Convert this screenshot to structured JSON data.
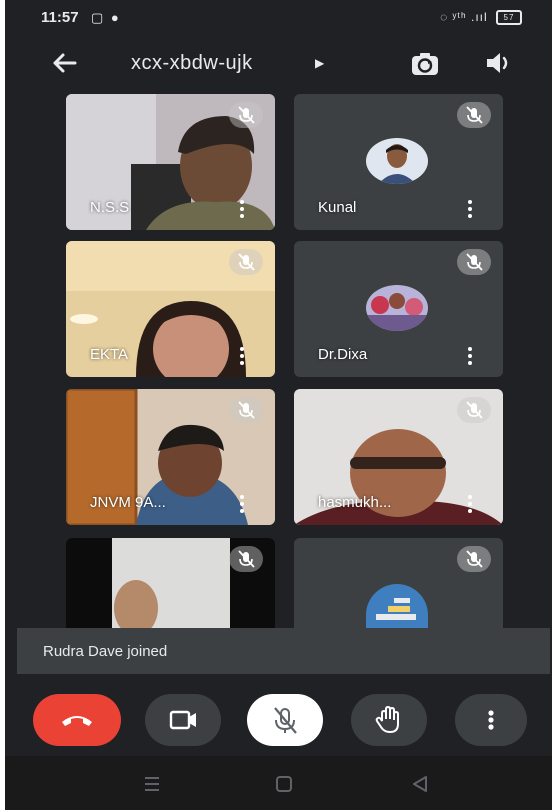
{
  "status_bar": {
    "time": "11:57",
    "left_icons": "▢ ●",
    "right_icons": "◌ ʸᵗʰ .ııl",
    "battery": "57"
  },
  "top_bar": {
    "meeting_code": "xcx-xbdw-ujk",
    "caret": "▶"
  },
  "participants": [
    {
      "name": "N.S.S",
      "video": true
    },
    {
      "name": "Kunal",
      "video": false
    },
    {
      "name": "EKTA",
      "video": true
    },
    {
      "name": "Dr.Dixa",
      "video": false
    },
    {
      "name": "JNVM 9A...",
      "video": true
    },
    {
      "name": "hasmukh...",
      "video": true
    },
    {
      "name": "",
      "video": true
    },
    {
      "name": "",
      "video": false
    }
  ],
  "toast": {
    "text": "Rudra Dave joined"
  },
  "controls": [
    "end-call",
    "camera",
    "microphone",
    "raise-hand",
    "more"
  ],
  "colors": {
    "end_call": "#ea4335",
    "background": "#202124",
    "tile": "#3c4043"
  }
}
